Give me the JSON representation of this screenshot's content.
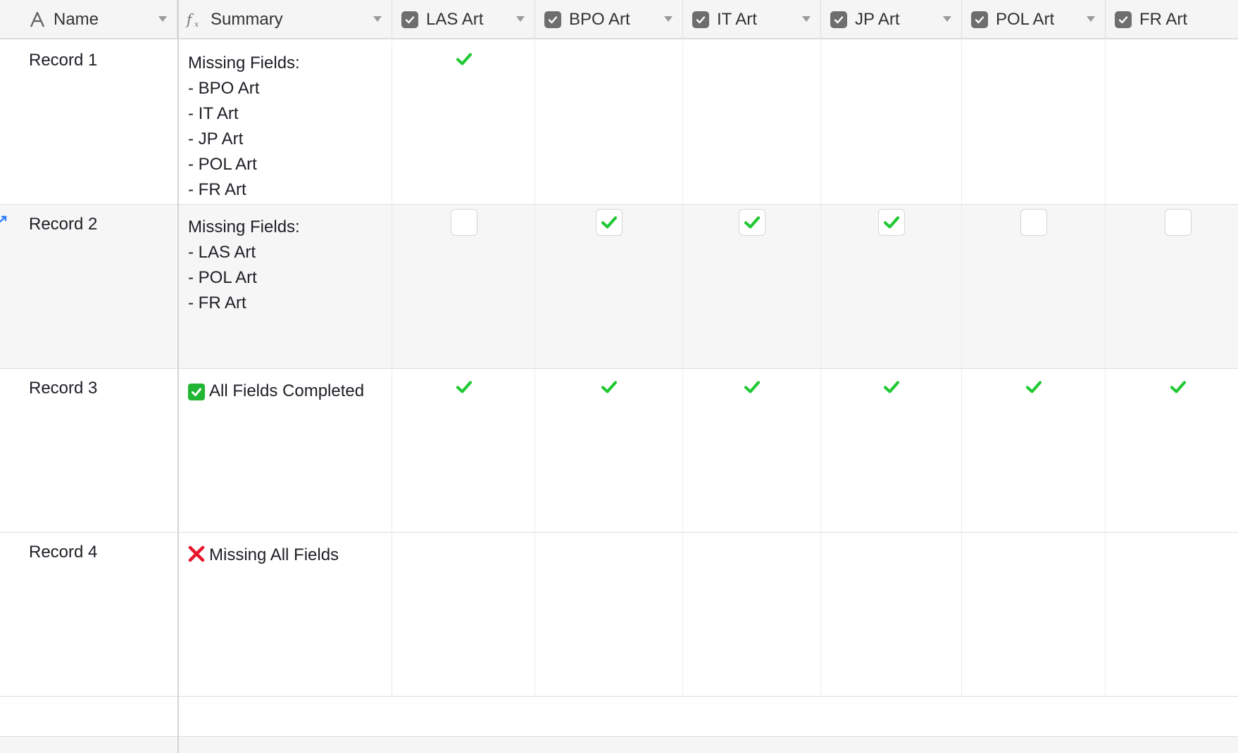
{
  "columns": [
    {
      "key": "name",
      "label": "Name",
      "icon": "text-field-icon"
    },
    {
      "key": "summary",
      "label": "Summary",
      "icon": "formula-icon"
    },
    {
      "key": "las",
      "label": "LAS Art",
      "icon": "checkbox-field-icon"
    },
    {
      "key": "bpo",
      "label": "BPO Art",
      "icon": "checkbox-field-icon"
    },
    {
      "key": "it",
      "label": "IT Art",
      "icon": "checkbox-field-icon"
    },
    {
      "key": "jp",
      "label": "JP Art",
      "icon": "checkbox-field-icon"
    },
    {
      "key": "pol",
      "label": "POL Art",
      "icon": "checkbox-field-icon"
    },
    {
      "key": "fr",
      "label": "FR Art",
      "icon": "checkbox-field-icon"
    }
  ],
  "rows": [
    {
      "name": "Record 1",
      "summary_icon": "",
      "summary": [
        "Missing Fields:",
        "- BPO Art",
        "- IT Art",
        "- JP Art",
        "- POL Art",
        "- FR Art"
      ],
      "checks": [
        true,
        false,
        false,
        false,
        false,
        false
      ],
      "hovered": false
    },
    {
      "name": "Record 2",
      "summary_icon": "",
      "summary": [
        "Missing Fields:",
        "- LAS Art",
        "- POL Art",
        "- FR Art"
      ],
      "checks": [
        false,
        true,
        true,
        true,
        false,
        false
      ],
      "hovered": true
    },
    {
      "name": "Record 3",
      "summary_icon": "check-mark-button-icon",
      "summary": [
        "All Fields Completed"
      ],
      "checks": [
        true,
        true,
        true,
        true,
        true,
        true
      ],
      "hovered": false
    },
    {
      "name": "Record 4",
      "summary_icon": "cross-mark-icon",
      "summary": [
        "Missing All Fields"
      ],
      "checks": [
        false,
        false,
        false,
        false,
        false,
        false
      ],
      "hovered": false
    }
  ],
  "colors": {
    "check_green": "#20c933",
    "header_bg": "#f5f5f5",
    "hover_bg": "#f6f6f6",
    "cross_red": "#e8152b",
    "expand_blue": "#2d7ff9"
  }
}
